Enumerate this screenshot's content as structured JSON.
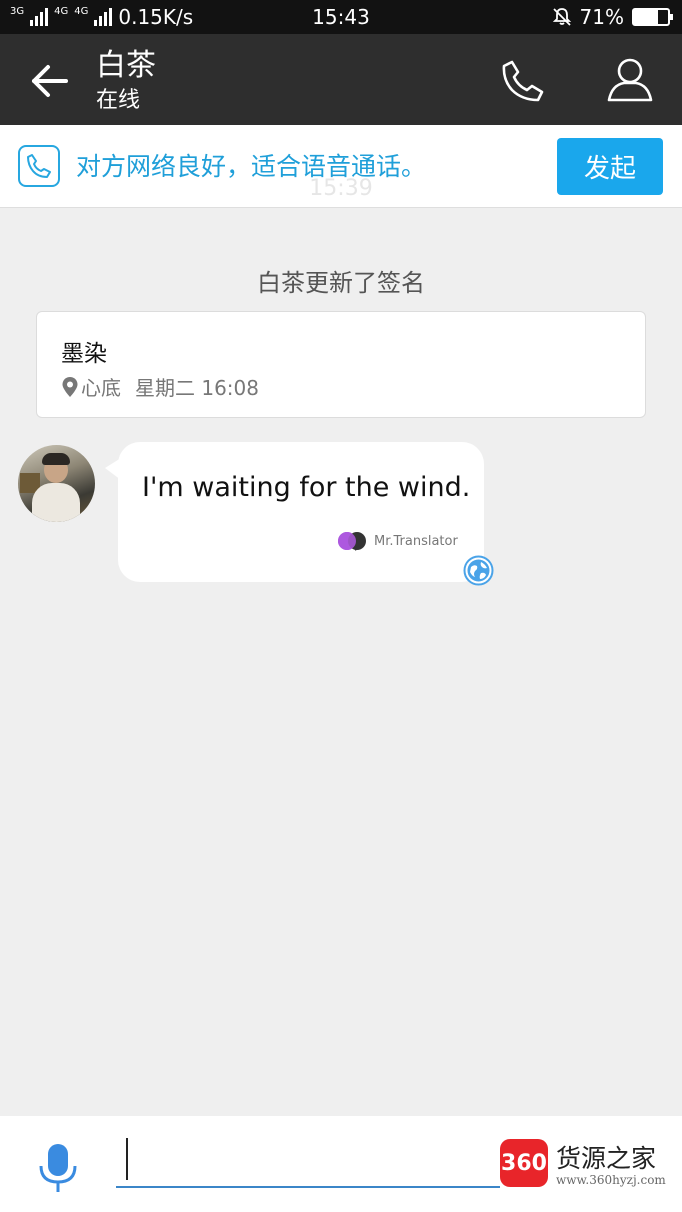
{
  "status_bar": {
    "net_tags": [
      "3G",
      "4G",
      "4G"
    ],
    "speed": "0.15K/s",
    "time": "15:43",
    "battery_percent": "71%",
    "battery_level": 0.71
  },
  "header": {
    "title": "白茶",
    "subtitle": "在线"
  },
  "banner": {
    "text": "对方网络良好，适合语音通话。",
    "button_label": "发起",
    "ghost_time": "15:39"
  },
  "system_message": "白茶更新了签名",
  "signature_card": {
    "text": "墨染",
    "location": "心底",
    "time": "星期二 16:08"
  },
  "message": {
    "text": "I'm waiting for the wind.",
    "translator_label": "Mr.Translator"
  },
  "input": {
    "value": ""
  },
  "watermark": {
    "logo": "360",
    "title": "货源之家",
    "url": "www.360hyzj.com"
  },
  "colors": {
    "accent": "#1aa7ec",
    "banner_text": "#1f9fd9",
    "header_bg": "#2e2e2e"
  }
}
